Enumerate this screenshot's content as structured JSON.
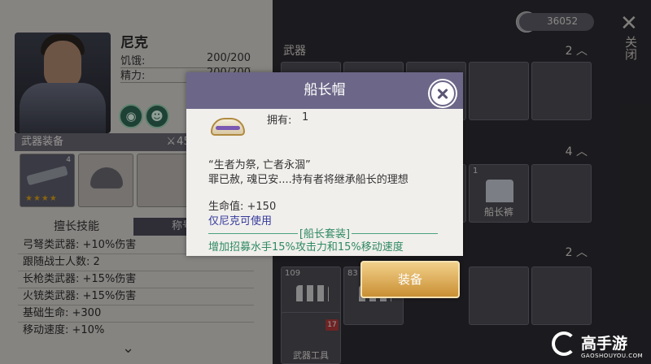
{
  "character": {
    "name": "尼克",
    "stats": [
      {
        "label": "饥饿:",
        "value": "200/200"
      },
      {
        "label": "精力:",
        "value": "200/200"
      }
    ]
  },
  "equipment": {
    "title": "武器装备",
    "power": "450",
    "weapon_tag": "4",
    "weapon_stars": "★★★★"
  },
  "skills": {
    "tab_active": "擅长技能",
    "tab_other": "称号",
    "items": [
      "弓弩类武器: +10%伤害",
      "跟随战士人数: 2",
      "长枪类武器: +15%伤害",
      "火铳类武器: +15%伤害",
      "基础生命: +300",
      "移动速度: +10%"
    ]
  },
  "currency": {
    "amount": "36052"
  },
  "side": {
    "close_label": "关闭"
  },
  "inventory": {
    "sections": [
      {
        "title": "武器",
        "count": "2"
      },
      {
        "title": "",
        "count": "4"
      },
      {
        "title": "",
        "count": "2"
      }
    ],
    "armor_item": {
      "num": "1",
      "label": "船长裤"
    },
    "ammo_items": [
      {
        "num": "109"
      },
      {
        "num": "83"
      }
    ],
    "tool": {
      "label": "武器工具",
      "badge": "17"
    }
  },
  "dialog": {
    "title": "船长帽",
    "own_label": "拥有:",
    "own_value": "1",
    "quote": "“生者为祭, 亡者永涸”",
    "flavor": "罪已赦, 魂已安....持有者将继承船长的理想",
    "hp": "生命值: +150",
    "restriction": "仅尼克可使用",
    "set_title": "[船长套装]",
    "set_desc": "增加招募水手15%攻击力和15%移动速度",
    "equip_button": "装备"
  },
  "watermark": {
    "name": "高手游",
    "site": "GAOSHOUYOU.COM"
  }
}
